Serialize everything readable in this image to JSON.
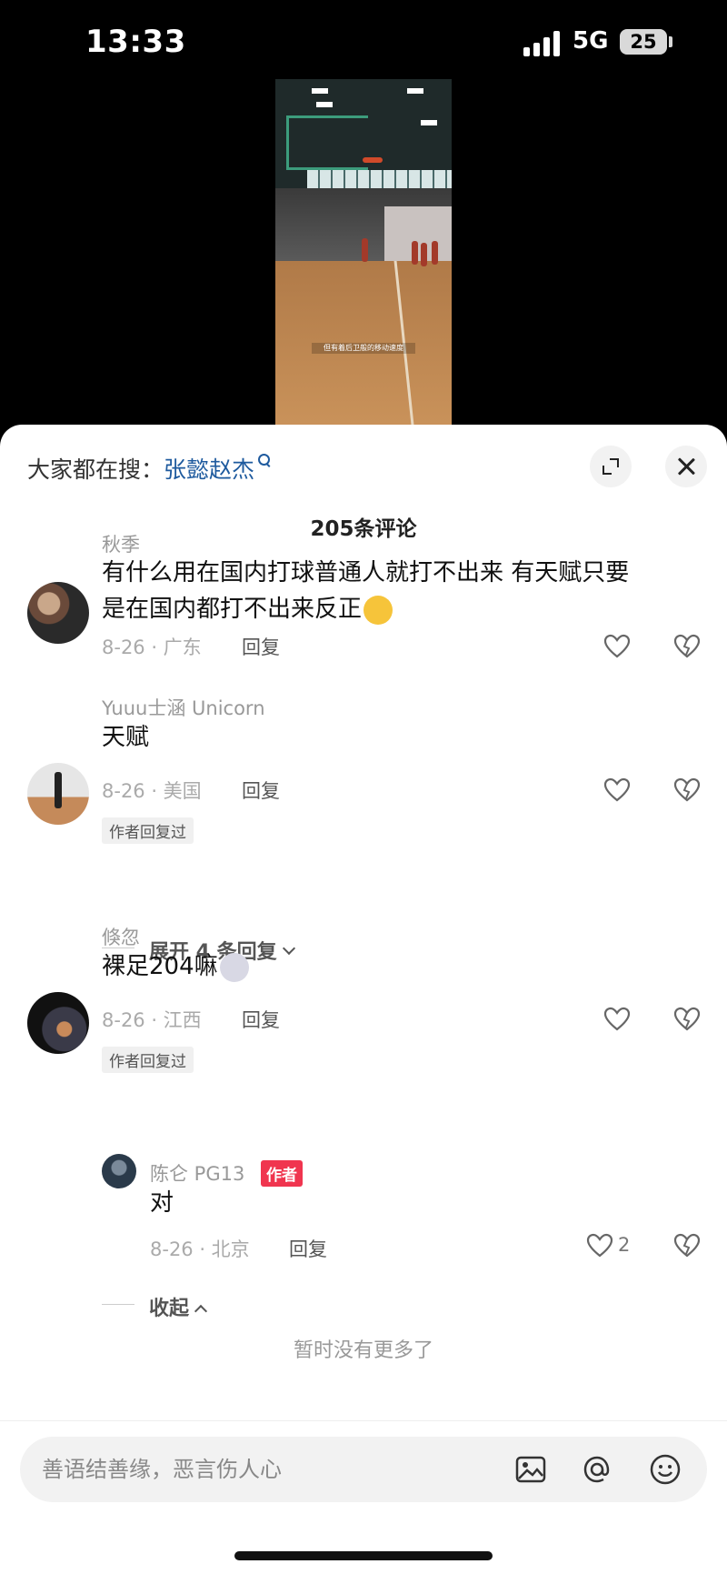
{
  "status_bar": {
    "time": "13:33",
    "network": "5G",
    "battery": "25"
  },
  "video": {
    "caption": "但有着后卫般的移动速度"
  },
  "search_hint": {
    "prefix": "大家都在搜：",
    "term": "张懿赵杰"
  },
  "comment_count": "205条评论",
  "comments": [
    {
      "username": "秋季",
      "text_line1": "有什么用在国内打球普通人就打不出来   有天赋只要",
      "text_line2": "是在国内都打不出来反正",
      "meta": "8-26 · 广东",
      "reply": "回复"
    },
    {
      "username": "Yuuu士涵 Unicorn",
      "text": "天赋",
      "meta": "8-26 · 美国",
      "reply": "回复",
      "author_replied": "作者回复过",
      "expand": "展开 4 条回复"
    },
    {
      "username": "倏忽",
      "text": "裸足204嘛",
      "meta": "8-26 · 江西",
      "reply": "回复",
      "author_replied": "作者回复过",
      "sub_reply": {
        "username": "陈仑 PG13",
        "badge": "作者",
        "text": "对",
        "meta": "8-26 · 北京",
        "reply": "回复",
        "likes": "2"
      },
      "collapse": "收起"
    }
  ],
  "no_more": "暂时没有更多了",
  "input": {
    "placeholder": "善语结善缘，恶言伤人心"
  },
  "colors": {
    "link": "#1e5a9e",
    "author_badge": "#f0354f"
  },
  "icons": [
    "search-icon",
    "expand-icon",
    "close-icon",
    "heart-icon",
    "dislike-icon",
    "image-icon",
    "at-icon",
    "emoji-icon"
  ]
}
